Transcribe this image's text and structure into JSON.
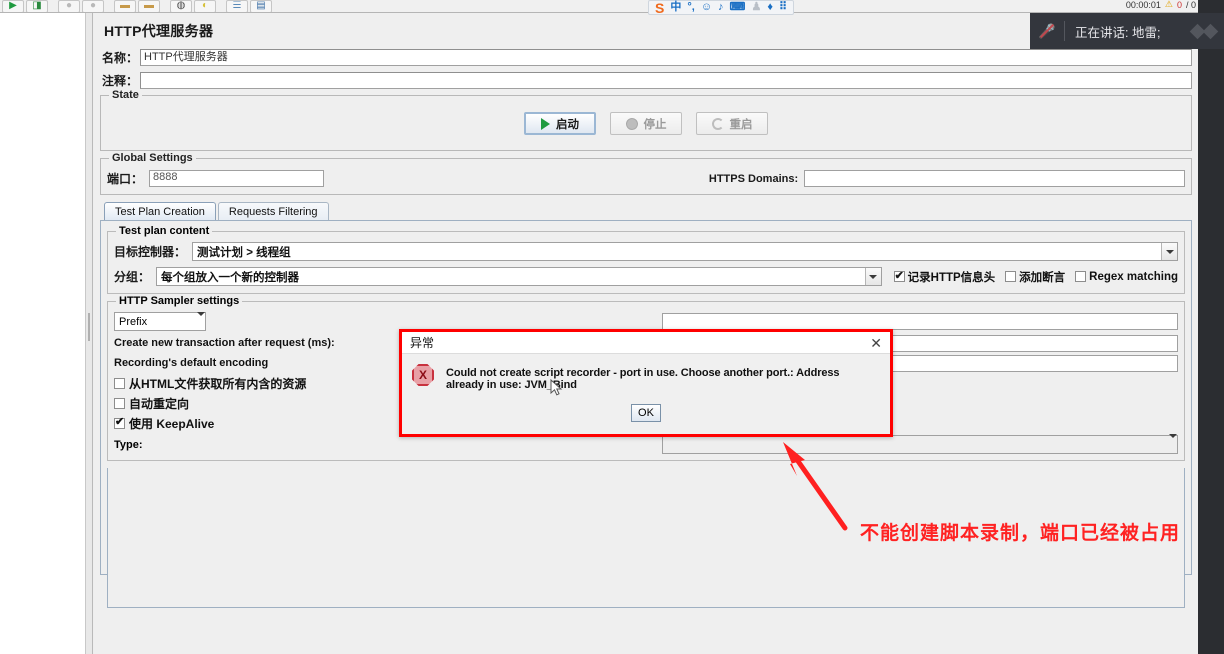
{
  "window": {
    "page_title": "HTTP代理服务器"
  },
  "toolbar": {
    "buttons": [
      {
        "name": "new",
        "glyph": "▶"
      },
      {
        "name": "templates",
        "glyph": "◨"
      },
      {
        "name": "open",
        "glyph": "●"
      },
      {
        "name": "close",
        "glyph": "●"
      },
      {
        "name": "save",
        "glyph": "▬"
      },
      {
        "name": "save-as",
        "glyph": "▬"
      },
      {
        "name": "cut",
        "glyph": "◍"
      },
      {
        "name": "copy",
        "glyph": "◐"
      },
      {
        "name": "paste",
        "glyph": "☰"
      },
      {
        "name": "expand",
        "glyph": "▤"
      }
    ]
  },
  "fields": {
    "name_label": "名称：",
    "name_value": "HTTP代理服务器",
    "comment_label": "注释：",
    "comment_value": ""
  },
  "state": {
    "title": "State",
    "start_label": "启动",
    "stop_label": "停止",
    "restart_label": "重启"
  },
  "global_settings": {
    "title": "Global Settings",
    "port_label": "端口：",
    "port_value": "8888",
    "https_label": "HTTPS Domains:",
    "https_value": ""
  },
  "tabs": [
    {
      "label": "Test Plan Creation",
      "active": true
    },
    {
      "label": "Requests Filtering",
      "active": false
    }
  ],
  "test_plan_content": {
    "title": "Test plan content",
    "target_controller_label": "目标控制器：",
    "target_controller_value": "测试计划 > 线程组",
    "grouping_label": "分组：",
    "grouping_value": "每个组放入一个新的控制器",
    "checkboxes": [
      {
        "label": "记录HTTP信息头",
        "checked": true
      },
      {
        "label": "添加断言",
        "checked": false
      },
      {
        "label": "Regex matching",
        "checked": false
      }
    ]
  },
  "sampler_settings": {
    "title": "HTTP Sampler settings",
    "prefix_value": "Prefix",
    "transaction_label": "Create new transaction after request (ms):",
    "encoding_label": "Recording's default encoding",
    "checkboxes": [
      {
        "label": "从HTML文件获取所有内含的资源",
        "checked": false
      },
      {
        "label": "自动重定向",
        "checked": false
      },
      {
        "label": "使用 KeepAlive",
        "checked": true
      }
    ],
    "type_label": "Type:",
    "type_value": ""
  },
  "dialog": {
    "title": "异常",
    "message": "Could not create script recorder - port in use. Choose another port.: Address already in use: JVM_Bind",
    "ok_label": "OK",
    "close_glyph": "✕",
    "error_glyph": "X",
    "border_color": "#ff0000"
  },
  "annotation": {
    "text": "不能创建脚本录制，端口已经被占用",
    "color": "#ff2222"
  },
  "ime": {
    "logo": "S",
    "items": [
      "中",
      "°,",
      "☺",
      "♪",
      "⌨",
      "♟",
      "♦",
      "⠿"
    ]
  },
  "voice_overlay": {
    "text": "正在讲话: 地雷;",
    "mic_glyph": "🎤"
  },
  "status": {
    "timer": "00:00:01",
    "warn_glyph": "⚠",
    "error_count": "0",
    "error_label": "/ 0"
  }
}
